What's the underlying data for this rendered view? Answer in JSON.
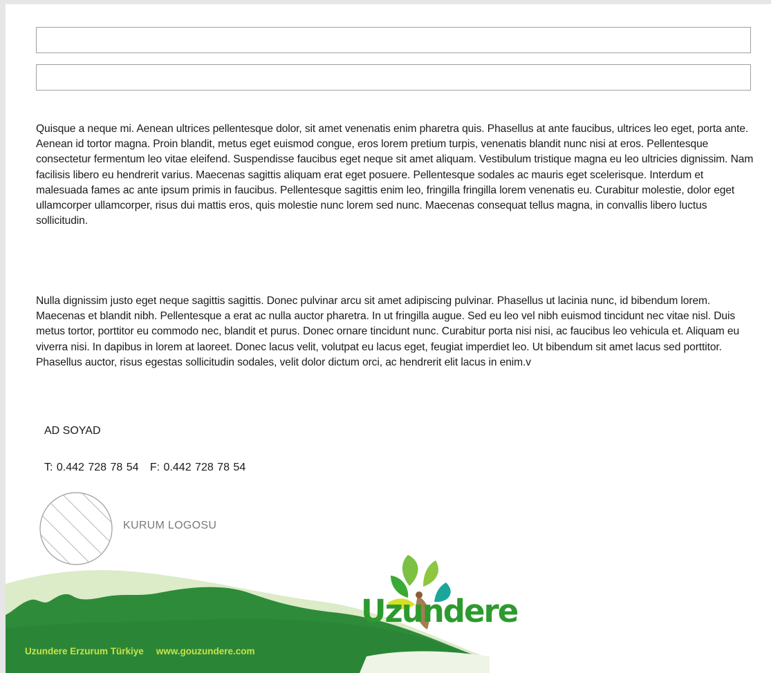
{
  "form": {
    "field1_value": "",
    "field2_value": ""
  },
  "body": {
    "paragraph1": "Quisque a neque mi. Aenean ultrices pellentesque dolor, sit amet venenatis enim pharetra quis. Phasellus at ante faucibus, ultrices leo eget, porta ante. Aenean id tortor magna. Proin blandit, metus eget euismod congue, eros lorem pretium turpis, venenatis blandit nunc nisi at eros. Pellentesque consectetur fermentum leo vitae eleifend. Suspendisse faucibus eget neque sit amet aliquam. Vestibulum tristique magna eu leo ultricies dignissim. Nam facilisis libero eu hendrerit varius. Maecenas sagittis aliquam erat eget posuere. Pellentesque sodales ac mauris eget scelerisque. Interdum et malesuada fames ac ante ipsum primis in faucibus. Pellentesque sagittis enim leo, fringilla fringilla lorem venenatis eu. Curabitur molestie, dolor eget ullamcorper ullamcorper, risus dui mattis eros, quis molestie nunc lorem sed nunc. Maecenas consequat tellus magna, in convallis libero luctus sollicitudin.",
    "paragraph2": "Nulla dignissim justo eget neque sagittis sagittis. Donec pulvinar arcu sit amet adipiscing pulvinar. Phasellus ut lacinia nunc, id bibendum lorem. Maecenas et blandit nibh. Pellentesque a erat ac nulla auctor pharetra. In ut fringilla augue. Sed eu leo vel nibh euismod tincidunt nec vitae nisl. Duis metus tortor, porttitor eu commodo nec, blandit et purus. Donec ornare tincidunt nunc. Curabitur porta nisi nisi, ac faucibus leo vehicula et. Aliquam eu viverra nisi. In dapibus in lorem at laoreet. Donec lacus velit, volutpat eu lacus eget, feugiat imperdiet leo. Ut bibendum sit amet lacus sed porttitor. Phasellus auctor, risus egestas sollicitudin sodales, velit dolor dictum orci, ac hendrerit elit lacus in enim.v"
  },
  "signature": {
    "name": "AD SOYAD",
    "phone": "T: 0.442 728 78 54   F: 0.442 728 78 54",
    "logo_placeholder": "KURUM LOGOSU"
  },
  "footer": {
    "location": "Uzundere Erzurum Türkiye",
    "website": "www.gouzundere.com",
    "brand": "Uzundere"
  },
  "colors": {
    "footer_green": "#2e8b3a",
    "footer_light": "#dcebc8",
    "footer_text": "#c8e24a",
    "brand_green": "#2d9a2f"
  },
  "icons": {
    "brand_logo": "leaf-flower-icon",
    "logo_placeholder": "hatched-circle-icon"
  }
}
